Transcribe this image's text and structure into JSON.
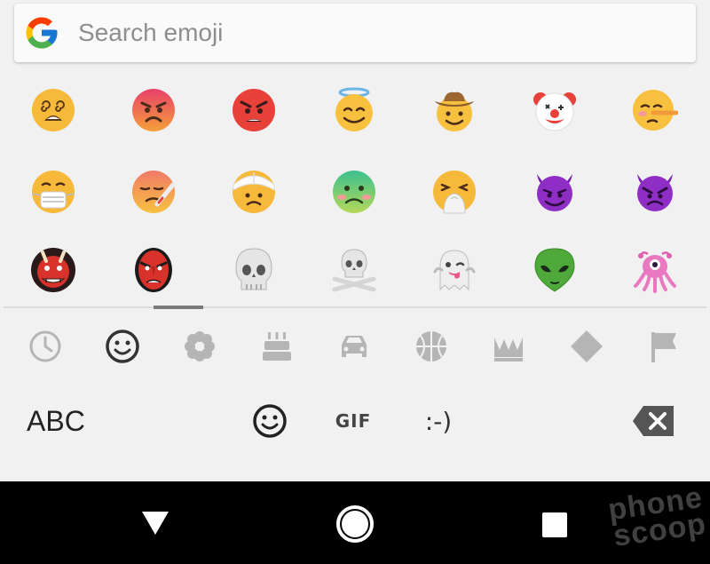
{
  "search": {
    "placeholder": "Search emoji"
  },
  "emoji_rows": [
    [
      "dizzy-face",
      "pouting-face",
      "angry-face",
      "smiling-face-with-halo",
      "cowboy-hat-face",
      "clown-face",
      "lying-face"
    ],
    [
      "face-with-medical-mask",
      "face-with-thermometer",
      "face-with-head-bandage",
      "nauseated-face",
      "sneezing-face",
      "smiling-face-with-horns",
      "angry-face-with-horns"
    ],
    [
      "japanese-ogre",
      "japanese-goblin",
      "skull",
      "skull-and-crossbones",
      "ghost",
      "alien",
      "alien-monster"
    ]
  ],
  "categories": [
    "recent",
    "smileys",
    "nature",
    "food",
    "travel",
    "activities",
    "objects",
    "symbols",
    "flags"
  ],
  "bottom_bar": {
    "abc_label": "ABC",
    "gif_label": "GIF",
    "emoticon_label": ":-)"
  },
  "watermark": {
    "line1": "phone",
    "line2": "scoop"
  },
  "colors": {
    "face_yellow": "#f7c13f",
    "angry_red": "#e8413a",
    "devil_purple": "#8e2ec5",
    "key_gray": "#b5b5b5"
  }
}
